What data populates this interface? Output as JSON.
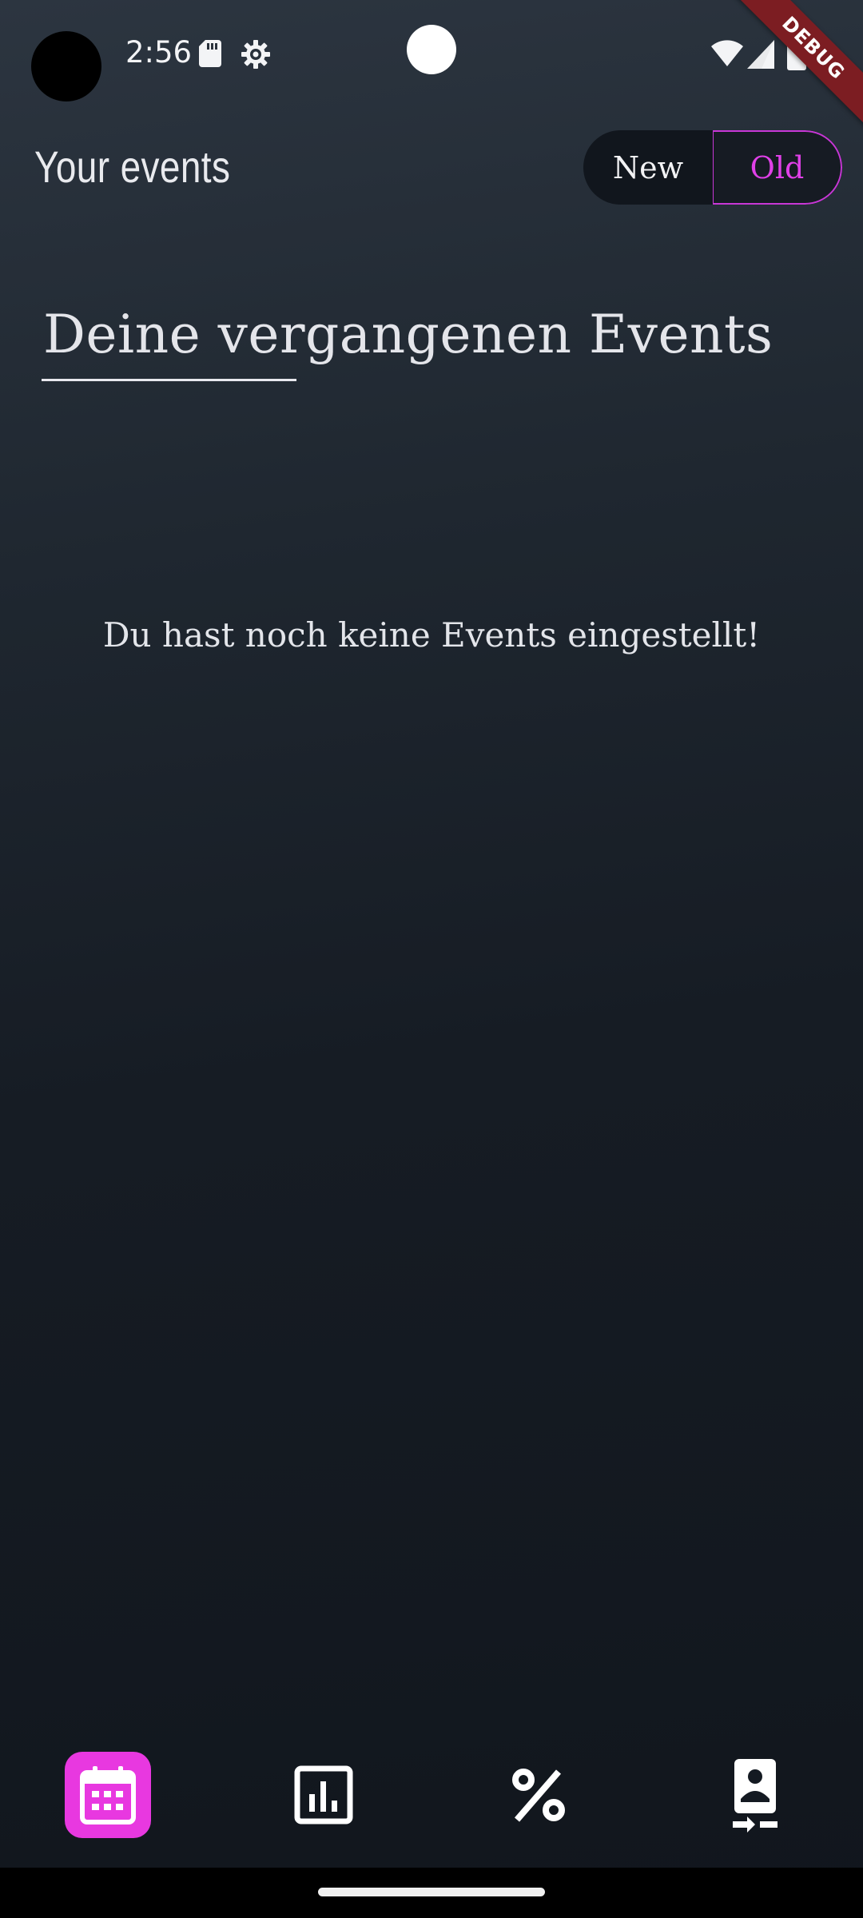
{
  "status_bar": {
    "time": "2:56",
    "icons": [
      "sd-card-icon",
      "gear-icon",
      "wifi-icon",
      "signal-icon",
      "battery-icon"
    ]
  },
  "debug_banner": "DEBUG",
  "header": {
    "title": "Your events",
    "toggle": {
      "new_label": "New",
      "old_label": "Old",
      "selected": "Old"
    }
  },
  "main": {
    "section_heading": "Deine vergangenen Events",
    "empty_message": "Du hast noch keine Events eingestellt!"
  },
  "bottom_nav": {
    "items": [
      {
        "icon": "calendar-icon",
        "active": true
      },
      {
        "icon": "bar-chart-icon",
        "active": false
      },
      {
        "icon": "percent-icon",
        "active": false
      },
      {
        "icon": "profile-transfer-icon",
        "active": false
      }
    ]
  },
  "colors": {
    "accent": "#e838e0",
    "toggle_selected_text": "#e040e8",
    "debug_ribbon": "#7c1d22"
  }
}
